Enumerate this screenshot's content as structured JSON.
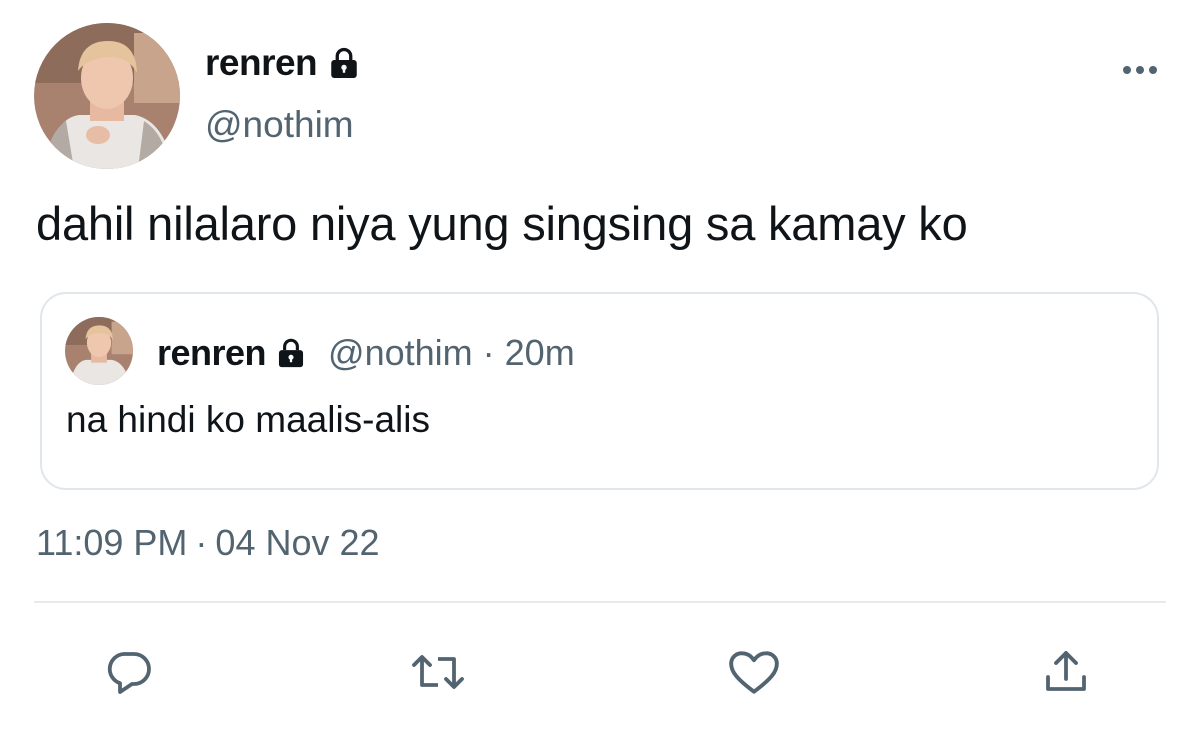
{
  "tweet": {
    "author": {
      "display_name": "renren",
      "handle": "@nothim",
      "protected_icon": "lock-icon",
      "avatar": "avatar-photo"
    },
    "text": "dahil nilalaro niya yung singsing sa kamay ko",
    "timestamp": {
      "time": "11:09 PM",
      "separator": "·",
      "date": "04 Nov 22"
    },
    "more_icon": "more-horizontal-icon"
  },
  "quoted_tweet": {
    "author": {
      "display_name": "renren",
      "handle": "@nothim",
      "protected_icon": "lock-icon",
      "avatar": "avatar-photo"
    },
    "separator": "·",
    "relative_time": "20m",
    "text": "na hindi ko maalis-alis"
  },
  "actions": [
    {
      "name": "reply",
      "icon": "reply-icon"
    },
    {
      "name": "retweet",
      "icon": "retweet-icon"
    },
    {
      "name": "like",
      "icon": "heart-icon"
    },
    {
      "name": "share",
      "icon": "share-icon"
    }
  ],
  "colors": {
    "primary_text": "#0f1419",
    "secondary_text": "#536471",
    "border": "#e1e6ea",
    "background": "#ffffff"
  }
}
